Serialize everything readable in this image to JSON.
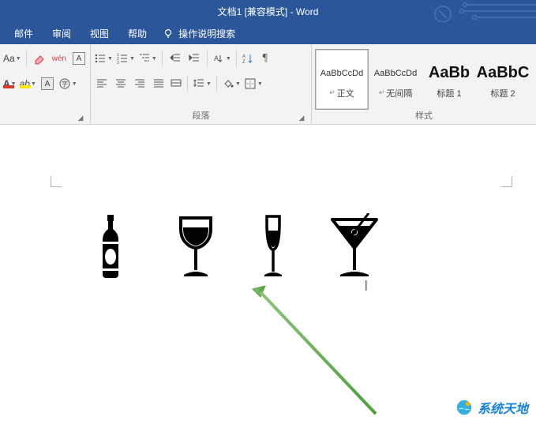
{
  "title": "文档1 [兼容模式] - Word",
  "menu": {
    "mail": "邮件",
    "review": "审阅",
    "view": "视图",
    "help": "帮助",
    "tell_me": "操作说明搜索"
  },
  "ribbon": {
    "font": {
      "font_size_label": "Aa",
      "phonetic_guide": "wén",
      "char_border": "A",
      "font_color_label": "A",
      "highlight_label": "ab",
      "char_shading": "A"
    },
    "paragraph": {
      "label": "段落",
      "show_hide": "¶"
    },
    "styles": {
      "label": "样式",
      "items": [
        {
          "preview": "AaBbCcDd",
          "name": "正文",
          "preview_class": "",
          "selected": true,
          "show_ret": true
        },
        {
          "preview": "AaBbCcDd",
          "name": "无间隔",
          "preview_class": "",
          "selected": false,
          "show_ret": true
        },
        {
          "preview": "AaBb",
          "name": "标题 1",
          "preview_class": "big",
          "selected": false,
          "show_ret": false
        },
        {
          "preview": "AaBbC",
          "name": "标题 2",
          "preview_class": "big",
          "selected": false,
          "show_ret": false
        }
      ]
    }
  },
  "watermark": "系统天地"
}
